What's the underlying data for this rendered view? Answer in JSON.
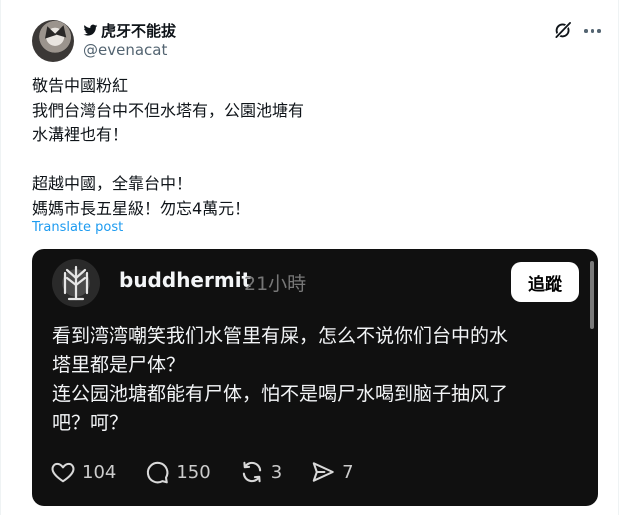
{
  "post": {
    "display_name": "虎牙不能拔",
    "handle": "@evenacat",
    "text_lines": [
      "敬告中國粉紅",
      "我們台灣台中不但水塔有，公園池塘有",
      "水溝裡也有！",
      "",
      "超越中國，全靠台中！",
      "媽媽市長五星級！勿忘4萬元！"
    ],
    "translate_label": "Translate post",
    "icons": {
      "name_prefix": "twitter-bird-icon",
      "top_right": "grok-icon",
      "menu": "more-icon"
    }
  },
  "embed": {
    "username": "buddhermit",
    "time": "21小時",
    "follow_label": "追蹤",
    "text_lines": [
      "看到湾湾嘲笑我们水管里有屎，怎么不说你们台中的水",
      "塔里都是尸体？",
      "连公园池塘都能有尸体，怕不是喝尸水喝到脑子抽风了",
      "吧？呵？"
    ],
    "stats": {
      "likes": "104",
      "comments": "150",
      "reposts": "3",
      "shares": "7"
    },
    "icons": [
      "heart-icon",
      "comment-icon",
      "repost-icon",
      "share-icon"
    ]
  },
  "colors": {
    "link": "#1d9bf0",
    "secondary_text": "#536471",
    "embed_background": "#101010"
  }
}
